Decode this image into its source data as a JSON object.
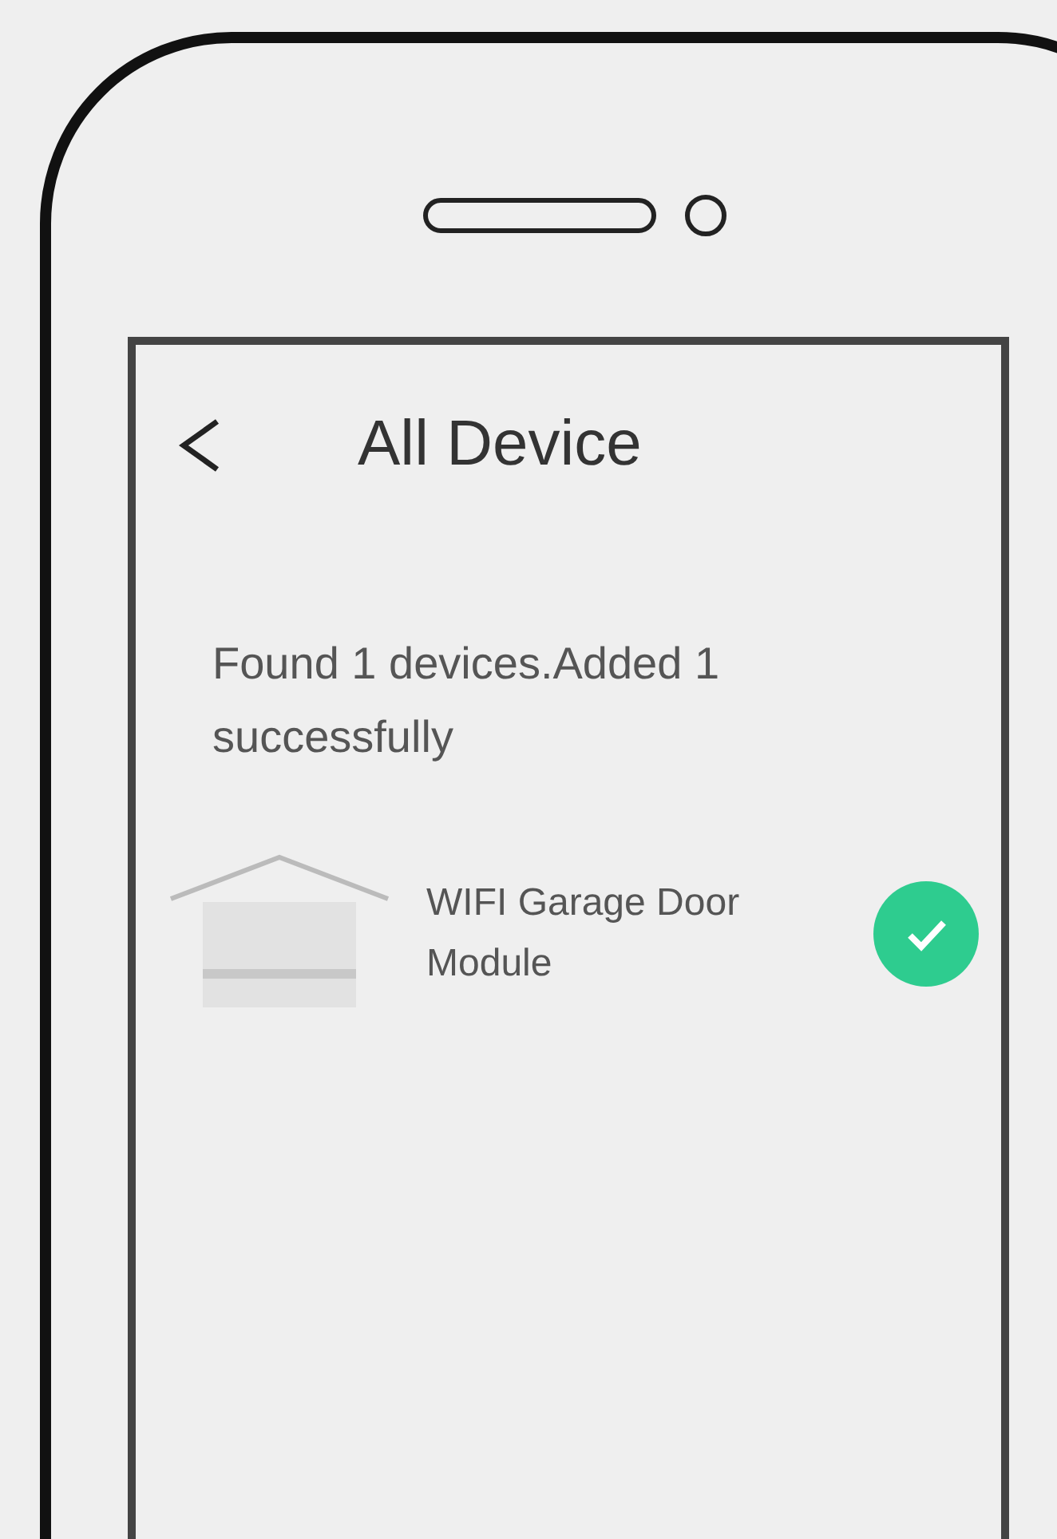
{
  "screen": {
    "title": "All Device",
    "message": "Found 1 devices.Added 1 successfully",
    "devices": [
      {
        "name": "WIFI Garage Door Module",
        "added": true
      }
    ]
  }
}
